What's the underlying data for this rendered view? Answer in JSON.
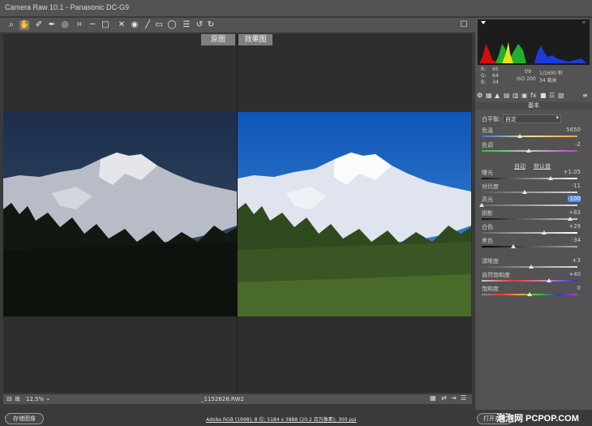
{
  "window": {
    "title": "Camera Raw 10.1 - Panasonic DC-G9"
  },
  "toolbar": {
    "tools": [
      "zoom-icon",
      "hand-icon",
      "white-balance-icon",
      "color-sampler-icon",
      "target-adjust-icon",
      "crop-icon",
      "straighten-icon",
      "transform-icon",
      "spot-removal-icon",
      "red-eye-icon",
      "brush-icon",
      "graduated-filter-icon",
      "radial-filter-icon",
      "preferences-icon",
      "rotate-left-icon",
      "rotate-right-icon"
    ]
  },
  "viewer": {
    "before_label": "原图",
    "after_label": "效果图"
  },
  "status": {
    "zoom": "12.5%",
    "filename": "_1152628.RW2"
  },
  "footer": {
    "save_label": "存储图像",
    "info": "Adobe RGB (1998); 8 位; 5184 x 3888 (20.2 百万像素); 300 ppi",
    "open_label": "打开对象",
    "watermark": "泡泡网 PCPOP.COM"
  },
  "readout": {
    "r_label": "R:",
    "r": "65",
    "g_label": "G:",
    "g": "64",
    "b_label": "B:",
    "b": "34",
    "aperture": "f/9",
    "shutter": "1/1600 秒",
    "iso": "ISO 200",
    "focal": "34 毫米"
  },
  "panel": {
    "title": "基本",
    "wb_label": "白平衡:",
    "wb_value": "自定",
    "auto_label": "自动",
    "default_label": "默认值",
    "sliders": [
      {
        "label": "色温",
        "value": "5650",
        "pos": 0.4
      },
      {
        "label": "色调",
        "value": "-2",
        "pos": 0.49
      },
      {
        "label": "曝光",
        "value": "+1.05",
        "pos": 0.72
      },
      {
        "label": "对比度",
        "value": "-11",
        "pos": 0.45
      },
      {
        "label": "高光",
        "value": "-100",
        "pos": 0.0
      },
      {
        "label": "阴影",
        "value": "+83",
        "pos": 0.92
      },
      {
        "label": "白色",
        "value": "+29",
        "pos": 0.65
      },
      {
        "label": "黑色",
        "value": "-34",
        "pos": 0.33
      },
      {
        "label": "清晰度",
        "value": "+3",
        "pos": 0.52
      },
      {
        "label": "自然饱和度",
        "value": "+40",
        "pos": 0.7
      },
      {
        "label": "饱和度",
        "value": "0",
        "pos": 0.5
      }
    ]
  },
  "colors": {
    "accent": "#4a8fdc",
    "panel_bg": "#535353"
  }
}
